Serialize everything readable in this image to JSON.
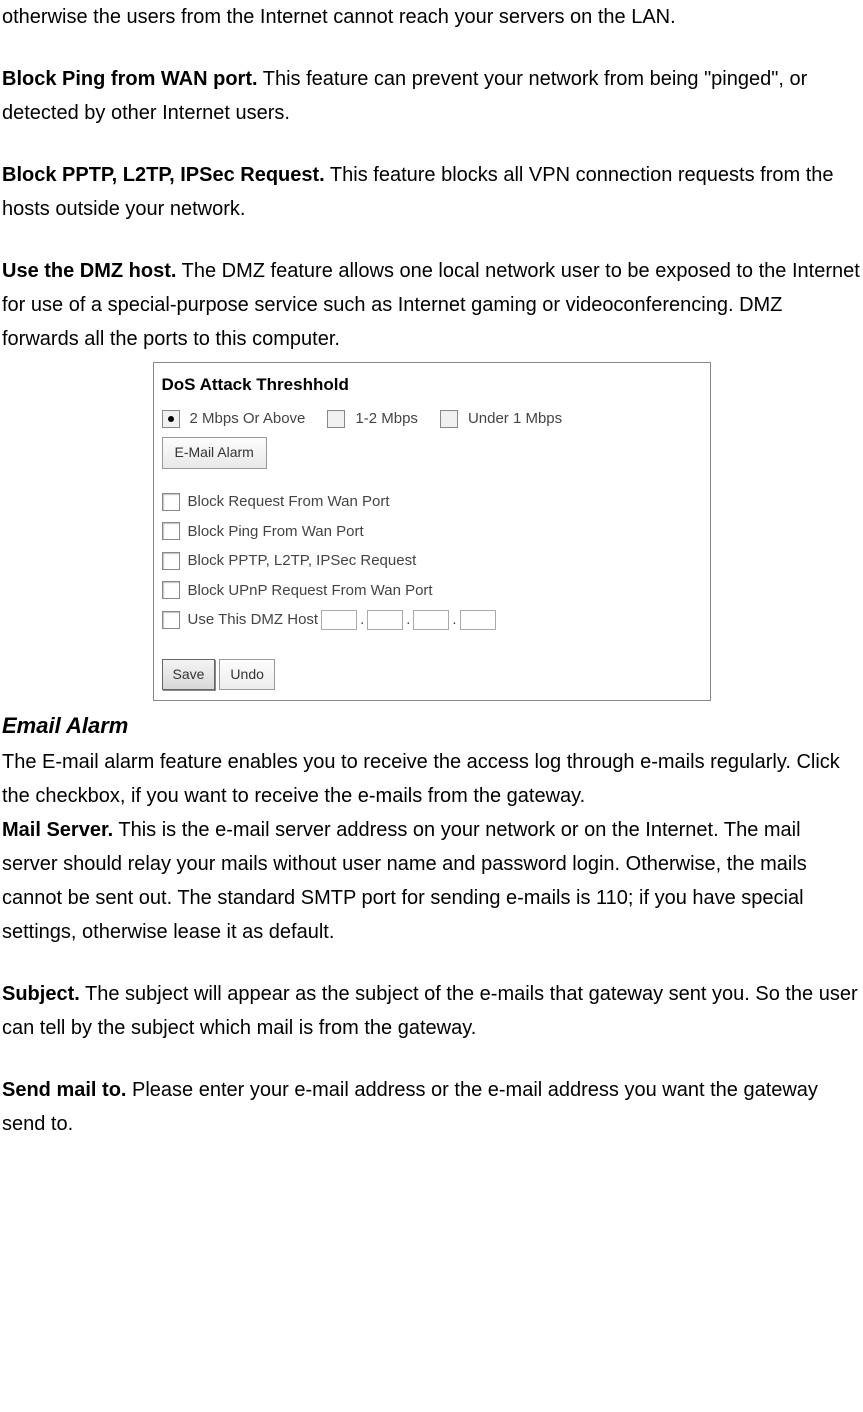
{
  "p1": "otherwise the users from the Internet cannot reach your servers on the LAN.",
  "p2_bold": "Block Ping from WAN port.",
  "p2_text": " This feature can prevent your network from being \"pinged\", or detected by other Internet users.",
  "p3_bold": "Block PPTP, L2TP, IPSec Request.",
  "p3_text": " This feature blocks all VPN connection requests from the hosts outside your network.",
  "p4_bold": "Use the DMZ host.",
  "p4_text": " The DMZ feature allows one local network user to be exposed to the Internet for use of a special-purpose service such as Internet gaming or videoconferencing. DMZ forwards all the ports to this computer.",
  "screenshot": {
    "title": "DoS Attack Threshhold",
    "radios": {
      "opt1": "2 Mbps Or Above",
      "opt2": "1-2 Mbps",
      "opt3": "Under 1 Mbps"
    },
    "email_btn": "E-Mail Alarm",
    "checkboxes": {
      "c1": "Block Request From Wan Port",
      "c2": "Block Ping From Wan Port",
      "c3": "Block PPTP, L2TP, IPSec Request",
      "c4": "Block UPnP Request From Wan Port",
      "c5": "Use This DMZ Host"
    },
    "save": "Save",
    "undo": "Undo"
  },
  "subheading": "Email Alarm",
  "p5": "The E-mail alarm feature enables you to receive the access log through e-mails regularly. Click the checkbox, if you want to receive the e-mails from the gateway.",
  "p6_bold": "Mail Server.",
  "p6_text": " This is the e-mail server address on your network or on the Internet. The mail server should relay your mails without user name and password login. Otherwise, the mails cannot be sent out. The standard SMTP port for sending e-mails is 110; if you have special settings, otherwise lease it as default.",
  "p7_bold": "Subject.",
  "p7_text": " The subject will appear as the subject of the e-mails that gateway sent you. So the user can tell by the subject which mail is from the gateway.",
  "p8_bold": "Send mail to.",
  "p8_text": " Please enter your e-mail address or the e-mail address you want the gateway send to."
}
